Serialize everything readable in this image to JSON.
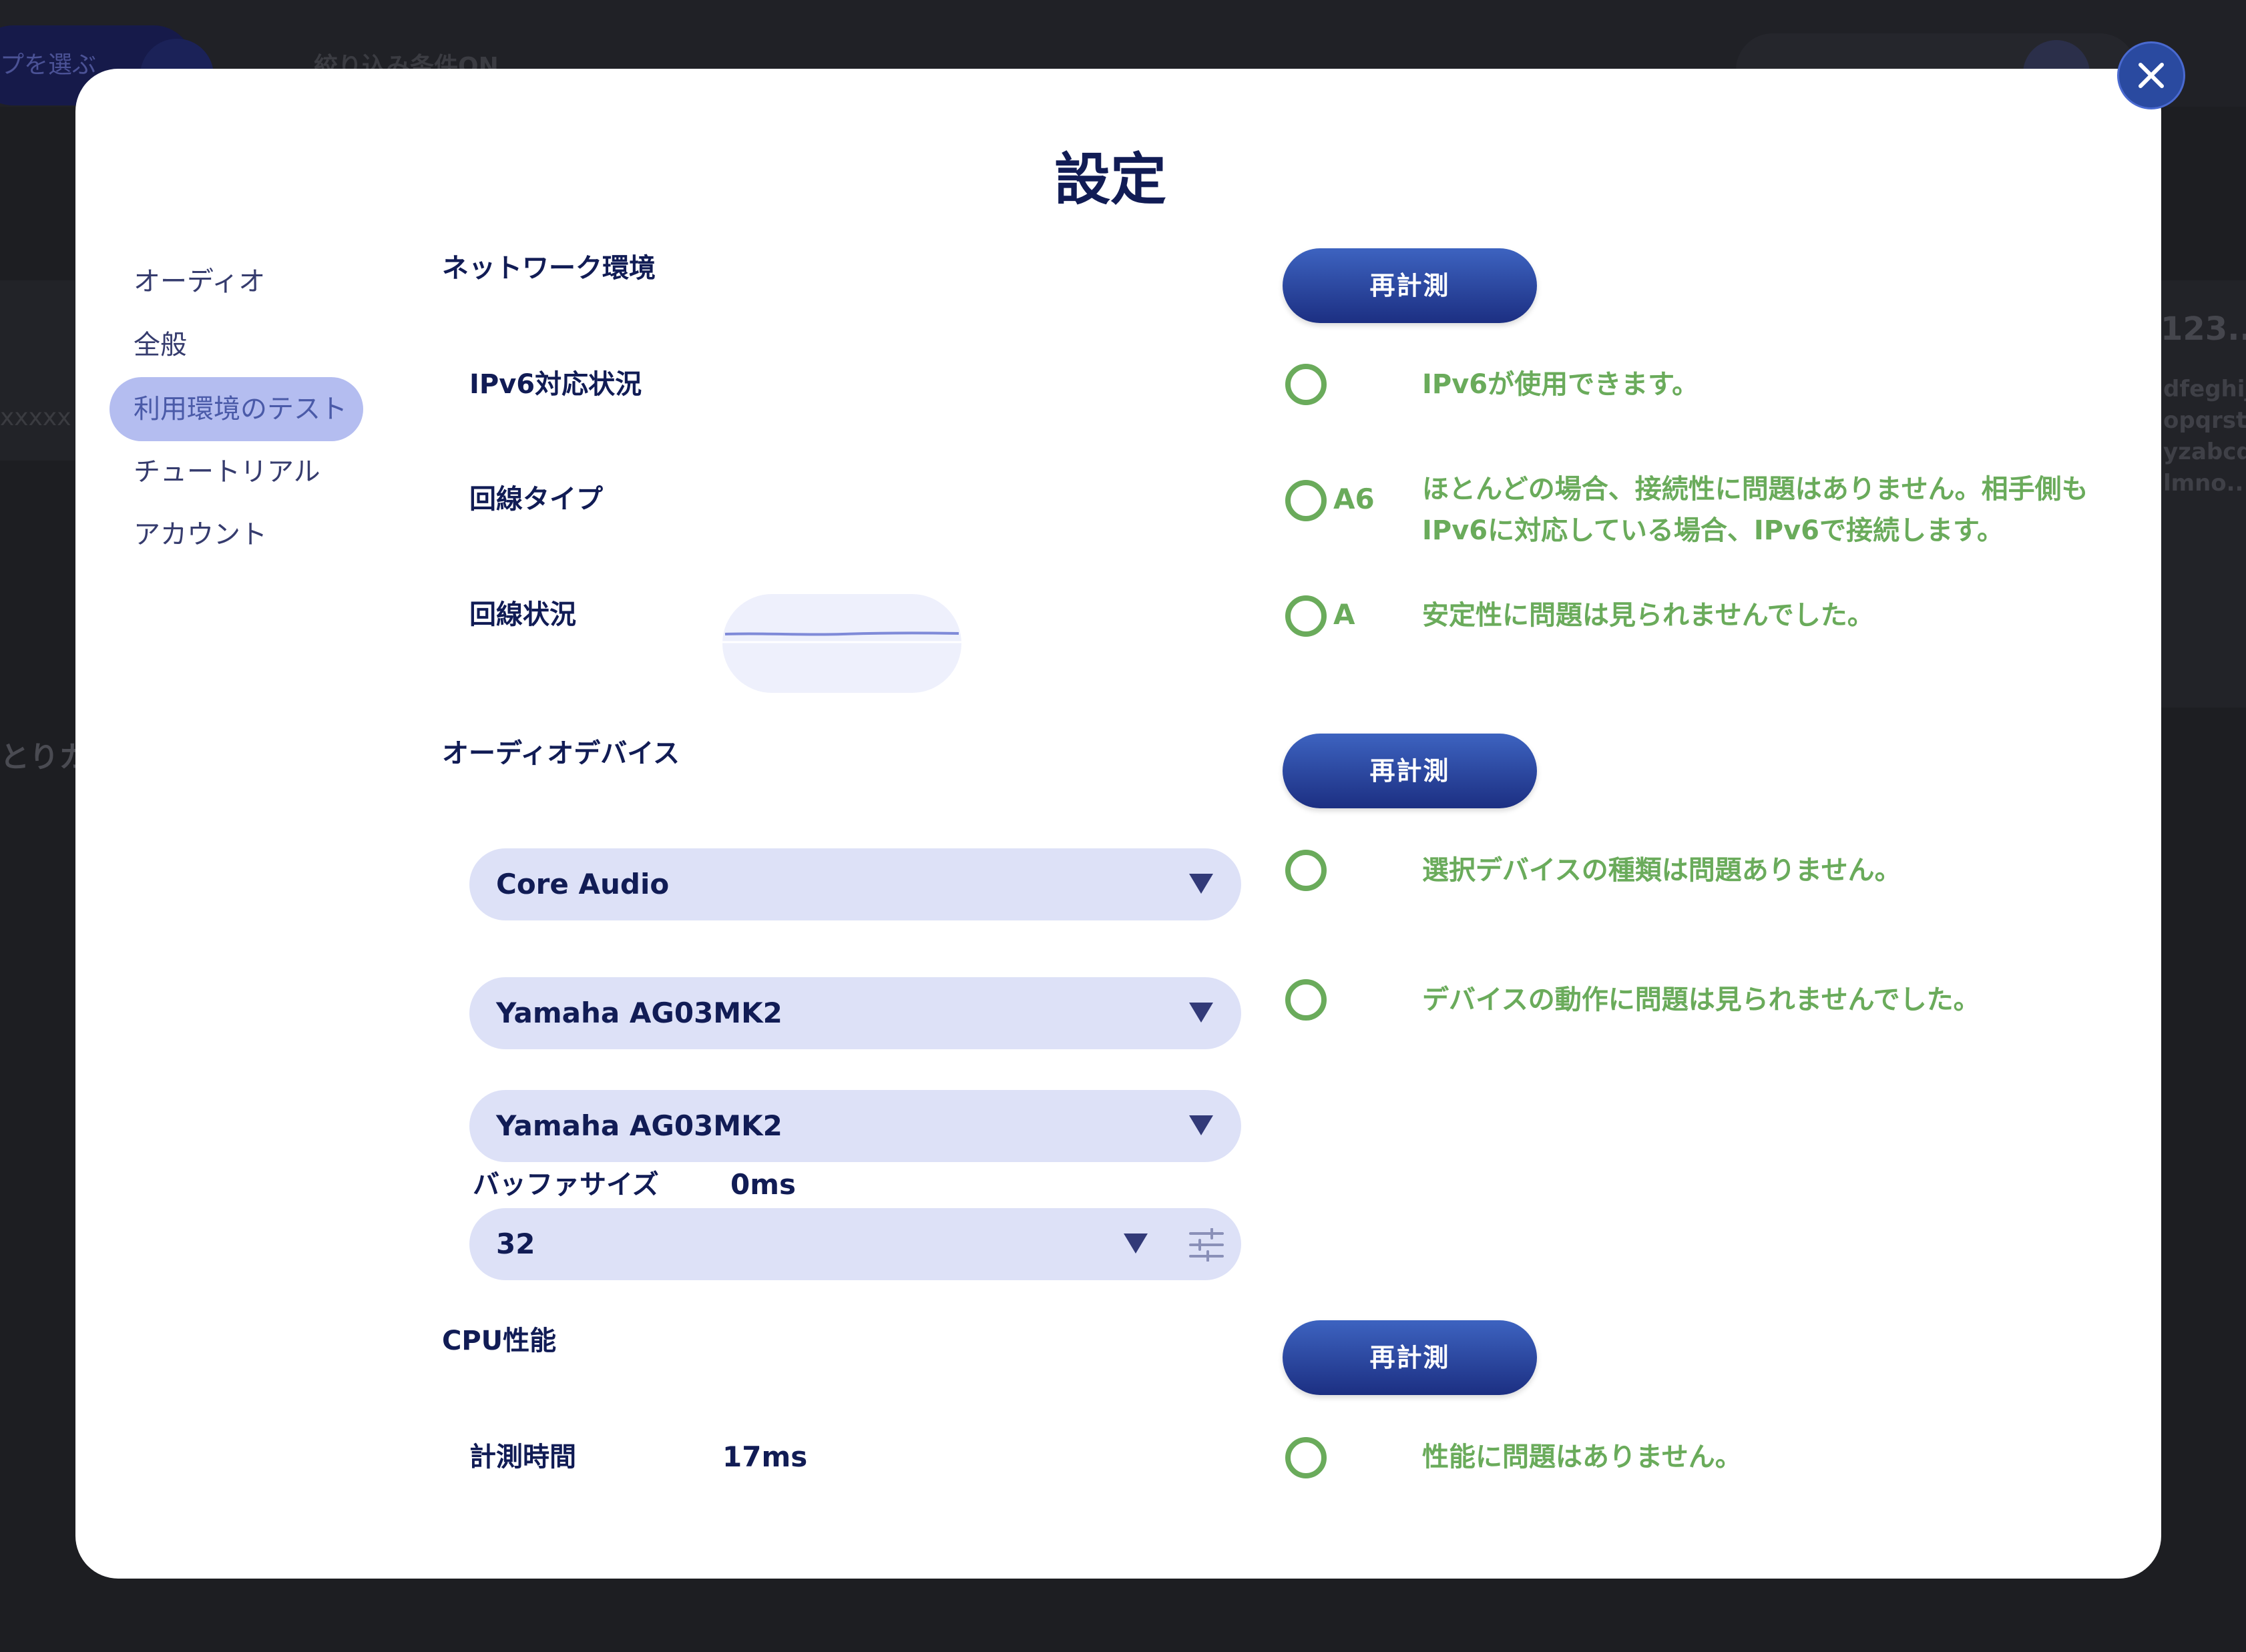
{
  "background": {
    "pill_text": "プを選ぶ",
    "filter_label": "絞り込み条件ON",
    "left_card_text": "xxxxx",
    "left_text": "とりカ",
    "right_title": "123...",
    "right_lines": [
      "dfeghijk",
      "opqrstu",
      "yzabcd",
      "lmno..."
    ]
  },
  "modal": {
    "title": "設定",
    "close_icon": "close-icon"
  },
  "nav": {
    "items": [
      {
        "label": "オーディオ"
      },
      {
        "label": "全般"
      },
      {
        "label": "利用環境のテスト"
      },
      {
        "label": "チュートリアル"
      },
      {
        "label": "アカウント"
      }
    ],
    "active_index": 2
  },
  "network": {
    "title": "ネットワーク環境",
    "remeasure_label": "再計測",
    "rows": [
      {
        "label": "IPv6対応状況",
        "grade": "",
        "message": "IPv6が使用できます。"
      },
      {
        "label": "回線タイプ",
        "grade": "A6",
        "message": "ほとんどの場合、接続性に問題はありません。相手側もIPv6に対応している場合、IPv6で接続します。"
      },
      {
        "label": "回線状況",
        "grade": "A",
        "message": "安定性に問題は見られませんでした。"
      }
    ]
  },
  "audio_device": {
    "title": "オーディオデバイス",
    "remeasure_label": "再計測",
    "driver_select": "Core Audio",
    "input_select": "Yamaha AG03MK2",
    "output_select": "Yamaha AG03MK2",
    "buffer_label": "バッファサイズ",
    "buffer_latency": "0ms",
    "buffer_select": "32",
    "messages": [
      "選択デバイスの種類は問題ありません。",
      "デバイスの動作に問題は見られませんでした。"
    ]
  },
  "cpu": {
    "title": "CPU性能",
    "remeasure_label": "再計測",
    "time_label": "計測時間",
    "time_value": "17ms",
    "message": "性能に問題はありません。"
  },
  "colors": {
    "accent": "#2a4aa0",
    "ok_green": "#6aab5b",
    "text_dark": "#111c55",
    "select_bg": "#dde1f7"
  }
}
